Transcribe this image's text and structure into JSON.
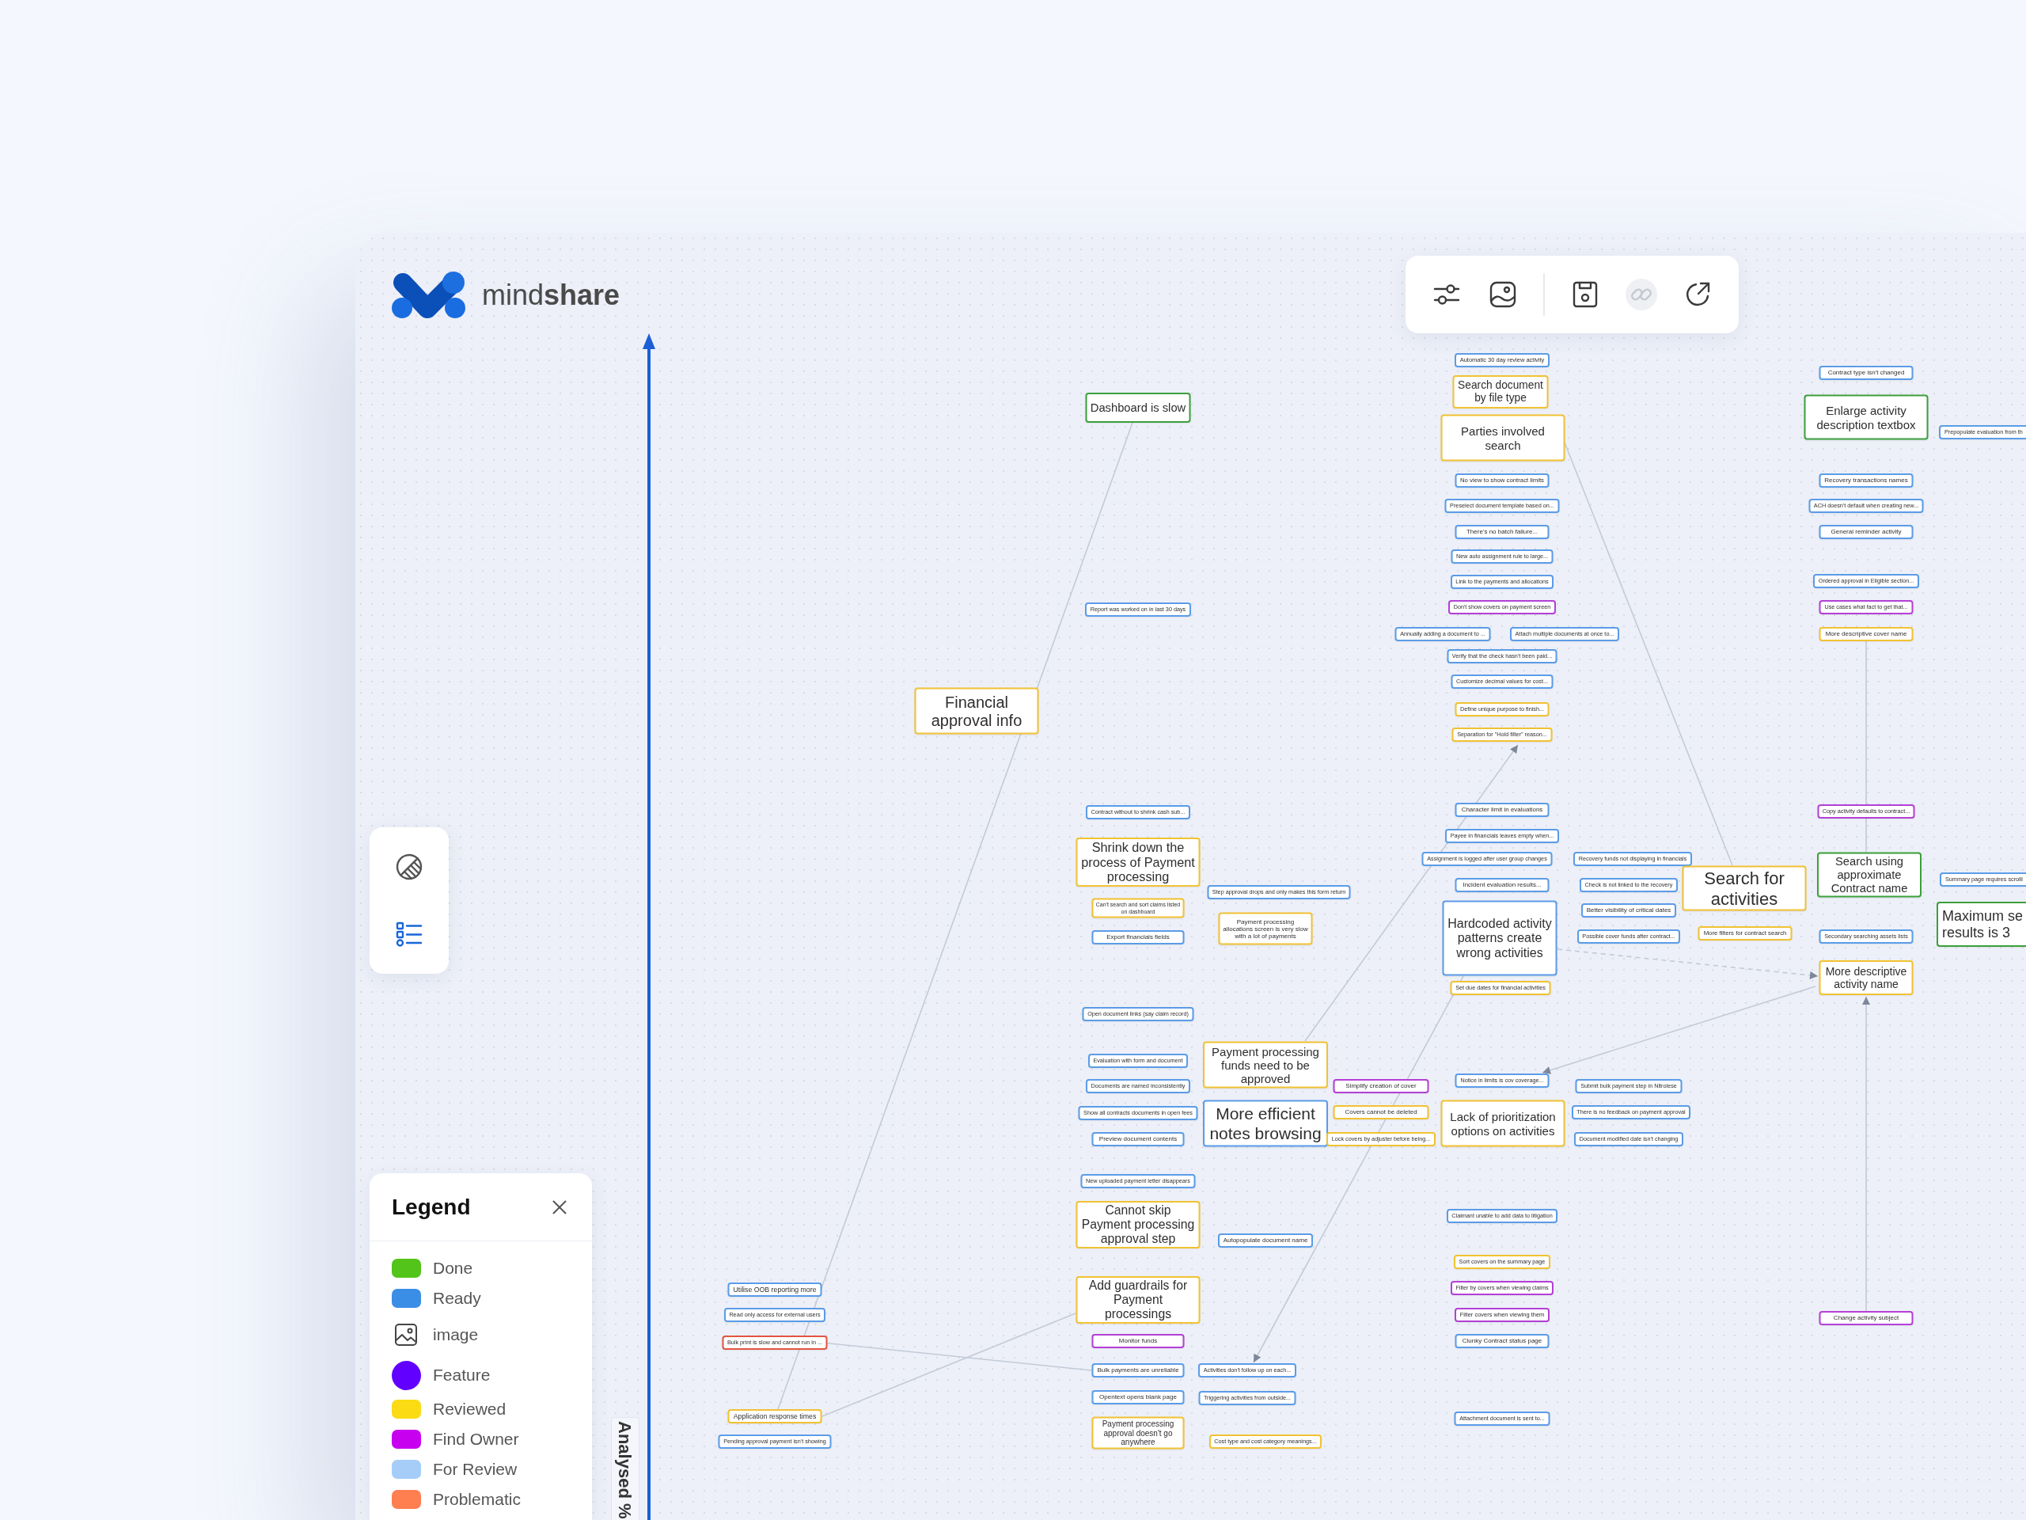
{
  "brand": {
    "name": "mind**share**"
  },
  "toolbar": {
    "buttons": [
      {
        "disabled": false
      },
      {
        "disabled": false
      },
      {
        "disabled": false
      },
      {
        "disabled": true
      },
      {
        "disabled": false
      }
    ]
  },
  "side_tools": [
    {
      "selected": false
    },
    {
      "selected": true
    }
  ],
  "legend": {
    "title": "Legend",
    "items": [
      {
        "kind": "swatch",
        "label": "Done",
        "color": "#52c41a"
      },
      {
        "kind": "swatch",
        "label": "Ready",
        "color": "#3a8ee6"
      },
      {
        "kind": "image",
        "label": "image"
      },
      {
        "kind": "dot",
        "label": "Feature",
        "color": "#6200ff"
      },
      {
        "kind": "swatch",
        "label": "Reviewed",
        "color": "#fadb14"
      },
      {
        "kind": "swatch",
        "label": "Find Owner",
        "color": "#c800f0"
      },
      {
        "kind": "swatch",
        "label": "For Review",
        "color": "#a5cdf8"
      },
      {
        "kind": "swatch",
        "label": "Problematic",
        "color": "#ff7f50"
      }
    ]
  },
  "axis": {
    "label": "Analysed %"
  },
  "mind_map": {
    "nodes": [
      {
        "text": "Financial approval info",
        "color": "#f1c232"
      },
      {
        "text": "Utilise OOB reporting more",
        "color": "#5b9ce8"
      },
      {
        "text": "Read only access for external users",
        "color": "#5b9ce8"
      },
      {
        "text": "Bulk print is slow and cannot run in ...",
        "color": "#e2553f"
      },
      {
        "text": "Application response times",
        "color": "#f1c232"
      },
      {
        "text": "Pending approval payment isn't showing",
        "color": "#5b9ce8"
      },
      {
        "text": "Dashboard is slow",
        "color": "#3c9f3c"
      },
      {
        "text": "Report was worked on in last 30 days",
        "color": "#5b9ce8"
      },
      {
        "text": "Contract without to shrink cash sub...",
        "color": "#5b9ce8"
      },
      {
        "text": "Shrink down the process of Payment processing",
        "color": "#f1c232"
      },
      {
        "text": "Can't search and sort claims listed on dashboard",
        "color": "#f1c232"
      },
      {
        "text": "Export financials fields",
        "color": "#5b9ce8"
      },
      {
        "text": "Open document links (say claim record)",
        "color": "#5b9ce8"
      },
      {
        "text": "Evaluation with form and document",
        "color": "#5b9ce8"
      },
      {
        "text": "Documents are named inconsistently",
        "color": "#5b9ce8"
      },
      {
        "text": "Show all contracts documents in open fees",
        "color": "#5b9ce8"
      },
      {
        "text": "Preview document contents",
        "color": "#5b9ce8"
      },
      {
        "text": "New uploaded payment letter disappears",
        "color": "#5b9ce8"
      },
      {
        "text": "Cannot skip Payment processing approval step",
        "color": "#f1c232"
      },
      {
        "text": "Add guardrails for Payment processings",
        "color": "#f1c232"
      },
      {
        "text": "Monitor funds",
        "color": "#b43fd6"
      },
      {
        "text": "Bulk payments are unreliable",
        "color": "#5b9ce8"
      },
      {
        "text": "Opentext opens blank page",
        "color": "#5b9ce8"
      },
      {
        "text": "Payment processing approval doesn't go anywhere",
        "color": "#f1c232"
      },
      {
        "text": "Step approval drops and only makes this form return",
        "color": "#5b9ce8"
      },
      {
        "text": "Payment processing allocations screen is very slow with a lot of payments",
        "color": "#f1c232"
      },
      {
        "text": "Payment processing funds need to be approved",
        "color": "#f1c232"
      },
      {
        "text": "More efficient notes browsing",
        "color": "#5b9ce8"
      },
      {
        "text": "Autopopulate document name",
        "color": "#5b9ce8"
      },
      {
        "text": "Activities don't follow up on each...",
        "color": "#5b9ce8"
      },
      {
        "text": "Triggering activities from outside...",
        "color": "#5b9ce8"
      },
      {
        "text": "Cost type and cost category meanings...",
        "color": "#f1c232"
      },
      {
        "text": "Annually adding a document to ...",
        "color": "#5b9ce8"
      },
      {
        "text": "Simplify creation of cover",
        "color": "#b43fd6"
      },
      {
        "text": "Covers cannot be deleted",
        "color": "#f1c232"
      },
      {
        "text": "Lock covers by adjuster before being...",
        "color": "#f1c232"
      },
      {
        "text": "Automatic 30 day review activity",
        "color": "#5b9ce8"
      },
      {
        "text": "Search document by file type",
        "color": "#f1c232"
      },
      {
        "text": "Parties involved search",
        "color": "#f1c232"
      },
      {
        "text": "No view to show contract limits",
        "color": "#5b9ce8"
      },
      {
        "text": "Preselect document template based on...",
        "color": "#5b9ce8"
      },
      {
        "text": "There's no batch failure...",
        "color": "#5b9ce8"
      },
      {
        "text": "New auto assignment rule to large...",
        "color": "#5b9ce8"
      },
      {
        "text": "Link to the payments and allocations",
        "color": "#5b9ce8"
      },
      {
        "text": "Don't show covers on payment screen",
        "color": "#b43fd6"
      },
      {
        "text": "Attach multiple documents at once to...",
        "color": "#5b9ce8"
      },
      {
        "text": "Verify that the check hasn't been paid...",
        "color": "#5b9ce8"
      },
      {
        "text": "Customize decimal values for cost...",
        "color": "#5b9ce8"
      },
      {
        "text": "Define unique purpose to finish...",
        "color": "#f1c232"
      },
      {
        "text": "Separation for \"Hold filter\" reason...",
        "color": "#f1c232"
      },
      {
        "text": "Character limit in evaluations",
        "color": "#5b9ce8"
      },
      {
        "text": "Payee in financials leaves empty when...",
        "color": "#5b9ce8"
      },
      {
        "text": "Assignment is logged after user group changes",
        "color": "#5b9ce8"
      },
      {
        "text": "Incident evaluation results...",
        "color": "#5b9ce8"
      },
      {
        "text": "Hardcoded activity patterns create wrong activities",
        "color": "#5b9ce8"
      },
      {
        "text": "Set due dates for financial activities",
        "color": "#f1c232"
      },
      {
        "text": "Notice in limits is cov coverage...",
        "color": "#5b9ce8"
      },
      {
        "text": "Lack of prioritization options on activities",
        "color": "#f1c232"
      },
      {
        "text": "Claimant unable to add data to litigation",
        "color": "#5b9ce8"
      },
      {
        "text": "Sort covers on the summary page",
        "color": "#f1c232"
      },
      {
        "text": "Filter by covers when viewing claims",
        "color": "#b43fd6"
      },
      {
        "text": "Filter covers when viewing them",
        "color": "#b43fd6"
      },
      {
        "text": "Clunky Contract status page",
        "color": "#5b9ce8"
      },
      {
        "text": "Attachment document is sent to...",
        "color": "#5b9ce8"
      },
      {
        "text": "Recovery funds not displaying in financials",
        "color": "#5b9ce8"
      },
      {
        "text": "Check is not linked to the recovery",
        "color": "#5b9ce8"
      },
      {
        "text": "Better visibility of critical dates",
        "color": "#5b9ce8"
      },
      {
        "text": "Possible cover funds after contract...",
        "color": "#5b9ce8"
      },
      {
        "text": "Submit bulk payment step in Nitrolese",
        "color": "#5b9ce8"
      },
      {
        "text": "There is no feedback on payment approval",
        "color": "#5b9ce8"
      },
      {
        "text": "Document modified date isn't changing",
        "color": "#5b9ce8"
      },
      {
        "text": "Search for activities",
        "color": "#f1c232"
      },
      {
        "text": "More filters for contract search",
        "color": "#f1c232"
      },
      {
        "text": "Contract type isn't changed",
        "color": "#5b9ce8"
      },
      {
        "text": "Enlarge activity description textbox",
        "color": "#3c9f3c"
      },
      {
        "text": "Recovery transactions names",
        "color": "#5b9ce8"
      },
      {
        "text": "ACH doesn't default when creating new...",
        "color": "#5b9ce8"
      },
      {
        "text": "General reminder activity",
        "color": "#5b9ce8"
      },
      {
        "text": "Ordered approval in Eligible section...",
        "color": "#5b9ce8"
      },
      {
        "text": "Use cases what fact to get that...",
        "color": "#b43fd6"
      },
      {
        "text": "More descriptive cover name",
        "color": "#f1c232"
      },
      {
        "text": "Copy activity defaults to contract...",
        "color": "#b43fd6"
      },
      {
        "text": "Search using approximate Contract name",
        "color": "#3c9f3c"
      },
      {
        "text": "Secondary searching assets lists",
        "color": "#5b9ce8"
      },
      {
        "text": "More descriptive activity name",
        "color": "#f1c232"
      },
      {
        "text": "Change activity subject",
        "color": "#b43fd6"
      },
      {
        "text": "Prepopulate evaluation from th",
        "color": "#5b9ce8"
      },
      {
        "text": "Summary page requires scrolli",
        "color": "#5b9ce8"
      },
      {
        "text": "Maximum se results is 3",
        "color": "#3c9f3c"
      }
    ]
  }
}
